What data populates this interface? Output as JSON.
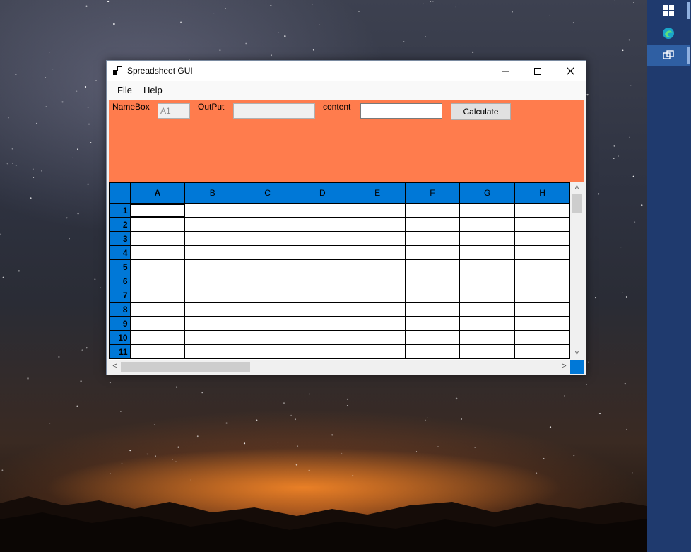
{
  "window": {
    "title": "Spreadsheet GUI",
    "minimize_icon": "minimize-icon",
    "maximize_icon": "maximize-icon",
    "close_icon": "close-icon"
  },
  "menu": {
    "items": [
      {
        "label": "File"
      },
      {
        "label": "Help"
      }
    ]
  },
  "toolbar": {
    "namebox_label": "NameBox",
    "namebox_value": "A1",
    "output_label": "OutPut",
    "output_value": "",
    "content_label": "content",
    "content_value": "",
    "calculate_label": "Calculate"
  },
  "grid": {
    "columns": [
      "A",
      "B",
      "C",
      "D",
      "E",
      "F",
      "G",
      "H"
    ],
    "rows": [
      "1",
      "2",
      "3",
      "4",
      "5",
      "6",
      "7",
      "8",
      "9",
      "10",
      "11"
    ],
    "selected_cell": "A1"
  },
  "colors": {
    "toolbar_bg": "#ff7c4d",
    "header_bg": "#0078d7",
    "taskbar_bg": "#1f3a6e"
  },
  "taskbar": {
    "icons": [
      "windows-start-icon",
      "edge-browser-icon",
      "task-view-icon"
    ]
  }
}
